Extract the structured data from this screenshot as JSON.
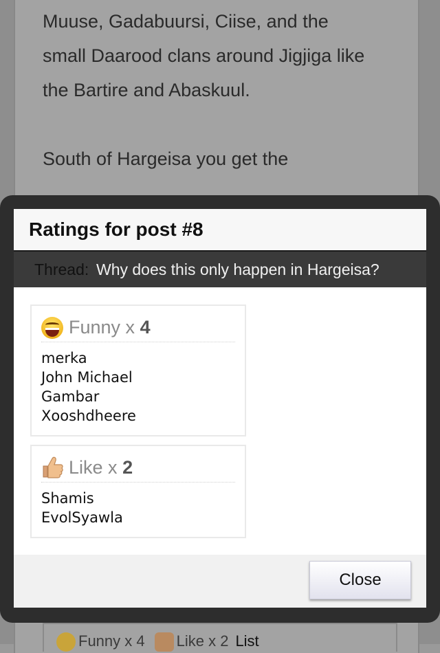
{
  "background": {
    "post_paragraph_1": "Muuse, Gadabuursi, Ciise, and the small Daarood clans around Jigjiga like the Bartire and Abaskuul.",
    "post_paragraph_2": "South of Hargeisa you get the",
    "footer": {
      "funny_label": "Funny x 4",
      "like_label": "Like x 2",
      "list_label": "List"
    }
  },
  "dialog": {
    "title": "Ratings for post #8",
    "thread_label": "Thread:",
    "thread_title": "Why does this only happen in Hargeisa?",
    "ratings": [
      {
        "icon": "laughing-emoji-icon",
        "label": "Funny x",
        "count": "4",
        "names": [
          "merka",
          "John Michael",
          "Gambar",
          "Xooshdheere"
        ]
      },
      {
        "icon": "thumbs-up-icon",
        "label": "Like x",
        "count": "2",
        "names": [
          "Shamis",
          "EvolSyawla"
        ]
      }
    ],
    "close_label": "Close"
  },
  "colors": {
    "overlay_frame": "#2d2d2d",
    "thread_bar": "#3a3a3a",
    "footer_bg": "#f1f1f1"
  }
}
